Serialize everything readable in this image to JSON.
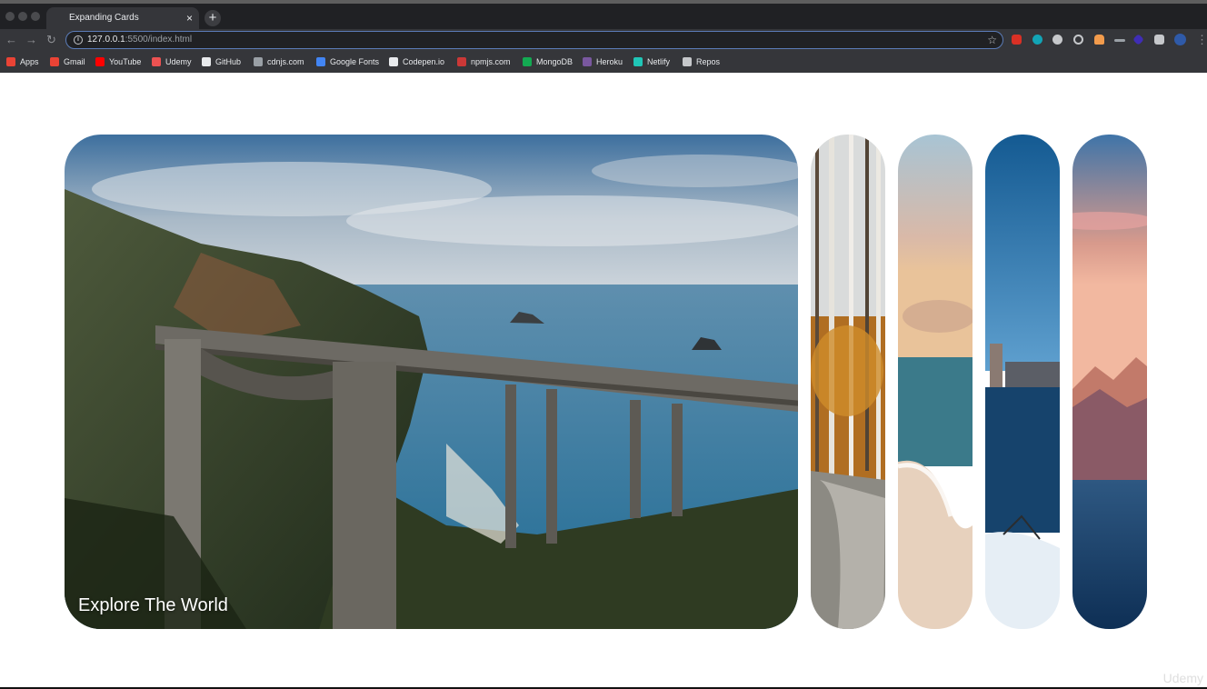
{
  "browser": {
    "tab_title": "Expanding Cards",
    "tab_close": "×",
    "new_tab": "+",
    "url_host": "127.0.0.1",
    "url_path": ":5500/index.html"
  },
  "bookmarks": [
    {
      "label": "Apps",
      "icon": "apps-grid-icon",
      "color": "#ea4335"
    },
    {
      "label": "Gmail",
      "icon": "gmail-icon",
      "color": "#ea4335"
    },
    {
      "label": "YouTube",
      "icon": "youtube-icon",
      "color": "#ff0000"
    },
    {
      "label": "Udemy",
      "icon": "udemy-icon",
      "color": "#ec5252"
    },
    {
      "label": "GitHub",
      "icon": "github-icon",
      "color": "#e8eaed"
    },
    {
      "label": "cdnjs.com",
      "icon": "code-icon",
      "color": "#9aa0a6"
    },
    {
      "label": "Google Fonts",
      "icon": "google-fonts-icon",
      "color": "#4285f4"
    },
    {
      "label": "Codepen.io",
      "icon": "codepen-icon",
      "color": "#e8eaed"
    },
    {
      "label": "npmjs.com",
      "icon": "npm-icon",
      "color": "#cb3837"
    },
    {
      "label": "MongoDB",
      "icon": "mongodb-leaf-icon",
      "color": "#13aa52"
    },
    {
      "label": "Heroku",
      "icon": "heroku-icon",
      "color": "#79589f"
    },
    {
      "label": "Netlify",
      "icon": "netlify-icon",
      "color": "#20c6b7"
    },
    {
      "label": "Repos",
      "icon": "folder-icon",
      "color": "#c6c8cb"
    }
  ],
  "panels": [
    {
      "title": "Explore The World",
      "active": true,
      "scene": "coastal-bridge"
    },
    {
      "title": "",
      "active": false,
      "scene": "autumn-forest"
    },
    {
      "title": "",
      "active": false,
      "scene": "beach-sunset"
    },
    {
      "title": "",
      "active": false,
      "scene": "city-lake-winter"
    },
    {
      "title": "",
      "active": false,
      "scene": "mountain-dusk"
    }
  ],
  "watermark": "Udemy"
}
